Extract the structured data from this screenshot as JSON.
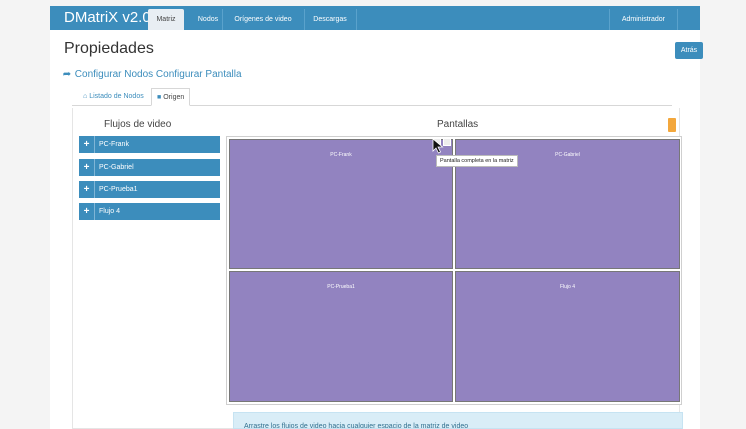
{
  "navbar": {
    "brand": "DMatriX v2.0",
    "tabs": [
      {
        "label": "Matriz",
        "active": true
      },
      {
        "label": "Nodos",
        "active": false
      },
      {
        "label": "Orígenes de video",
        "active": false
      },
      {
        "label": "Descargas",
        "active": false
      }
    ],
    "user": "Administrador",
    "color": "#3c8dbc"
  },
  "page": {
    "title": "Propiedades",
    "back_label": "Atrás",
    "breadcrumb": "Configurar Nodos Configurar Pantalla",
    "tabs": [
      {
        "label": "Listado de Nodos",
        "icon": "home-icon"
      },
      {
        "label": "Origen",
        "icon": "video-camera-icon"
      }
    ]
  },
  "flows": {
    "title": "Flujos de video",
    "items": [
      "PC-Frank",
      "PC-Gabriel",
      "PC-Prueba1",
      "Flujo 4"
    ],
    "item_color": "#3c8dbc"
  },
  "screens": {
    "title": "Pantallas",
    "cells": [
      "PC-Frank",
      "PC-Gabriel",
      "PC-Prueba1",
      "Flujo 4"
    ],
    "cell_color": "#9283c0",
    "tooltip": "Pantalla completa en la matriz"
  },
  "info": "Arrastre los flujos de video hacia cualquier espacio de la matriz de video"
}
